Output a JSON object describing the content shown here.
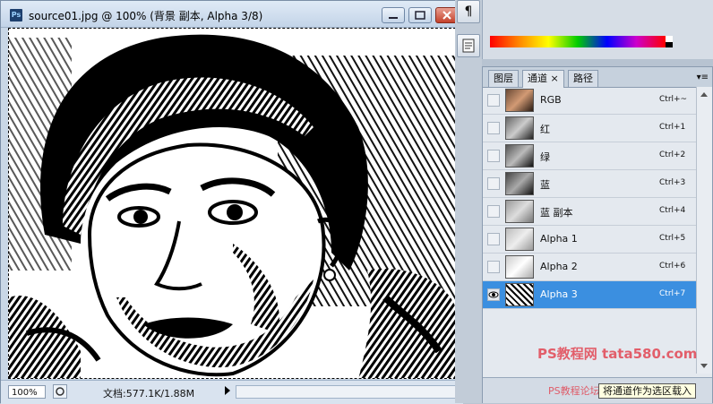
{
  "document": {
    "title": "source01.jpg @ 100% (背景 副本, Alpha 3/8)",
    "app_icon_label": "Ps",
    "zoom": "100%",
    "doc_info": "文档:577.1K/1.88M"
  },
  "dock": {
    "paragraph_glyph": "¶"
  },
  "channels_panel": {
    "tabs": [
      {
        "label": "图层"
      },
      {
        "label": "通道"
      },
      {
        "label": "路径"
      }
    ],
    "tab_close_glyph": "×",
    "active_tab": "通道",
    "menu_glyph": "▾≡",
    "channels": [
      {
        "name": "RGB",
        "shortcut": "Ctrl+~",
        "visible": false,
        "selected": false
      },
      {
        "name": "红",
        "shortcut": "Ctrl+1",
        "visible": false,
        "selected": false
      },
      {
        "name": "绿",
        "shortcut": "Ctrl+2",
        "visible": false,
        "selected": false
      },
      {
        "name": "蓝",
        "shortcut": "Ctrl+3",
        "visible": false,
        "selected": false
      },
      {
        "name": "蓝 副本",
        "shortcut": "Ctrl+4",
        "visible": false,
        "selected": false
      },
      {
        "name": "Alpha 1",
        "shortcut": "Ctrl+5",
        "visible": false,
        "selected": false
      },
      {
        "name": "Alpha 2",
        "shortcut": "Ctrl+6",
        "visible": false,
        "selected": false
      },
      {
        "name": "Alpha 3",
        "shortcut": "Ctrl+7",
        "visible": true,
        "selected": true
      }
    ]
  },
  "tooltip": "将通道作为选区载入",
  "watermark": {
    "text": "PS教程网 tata580.com",
    "subtext": "PS教程论坛"
  },
  "colors": {
    "selection": "#3b8fe0",
    "panel_bg": "#e4e9ef"
  }
}
